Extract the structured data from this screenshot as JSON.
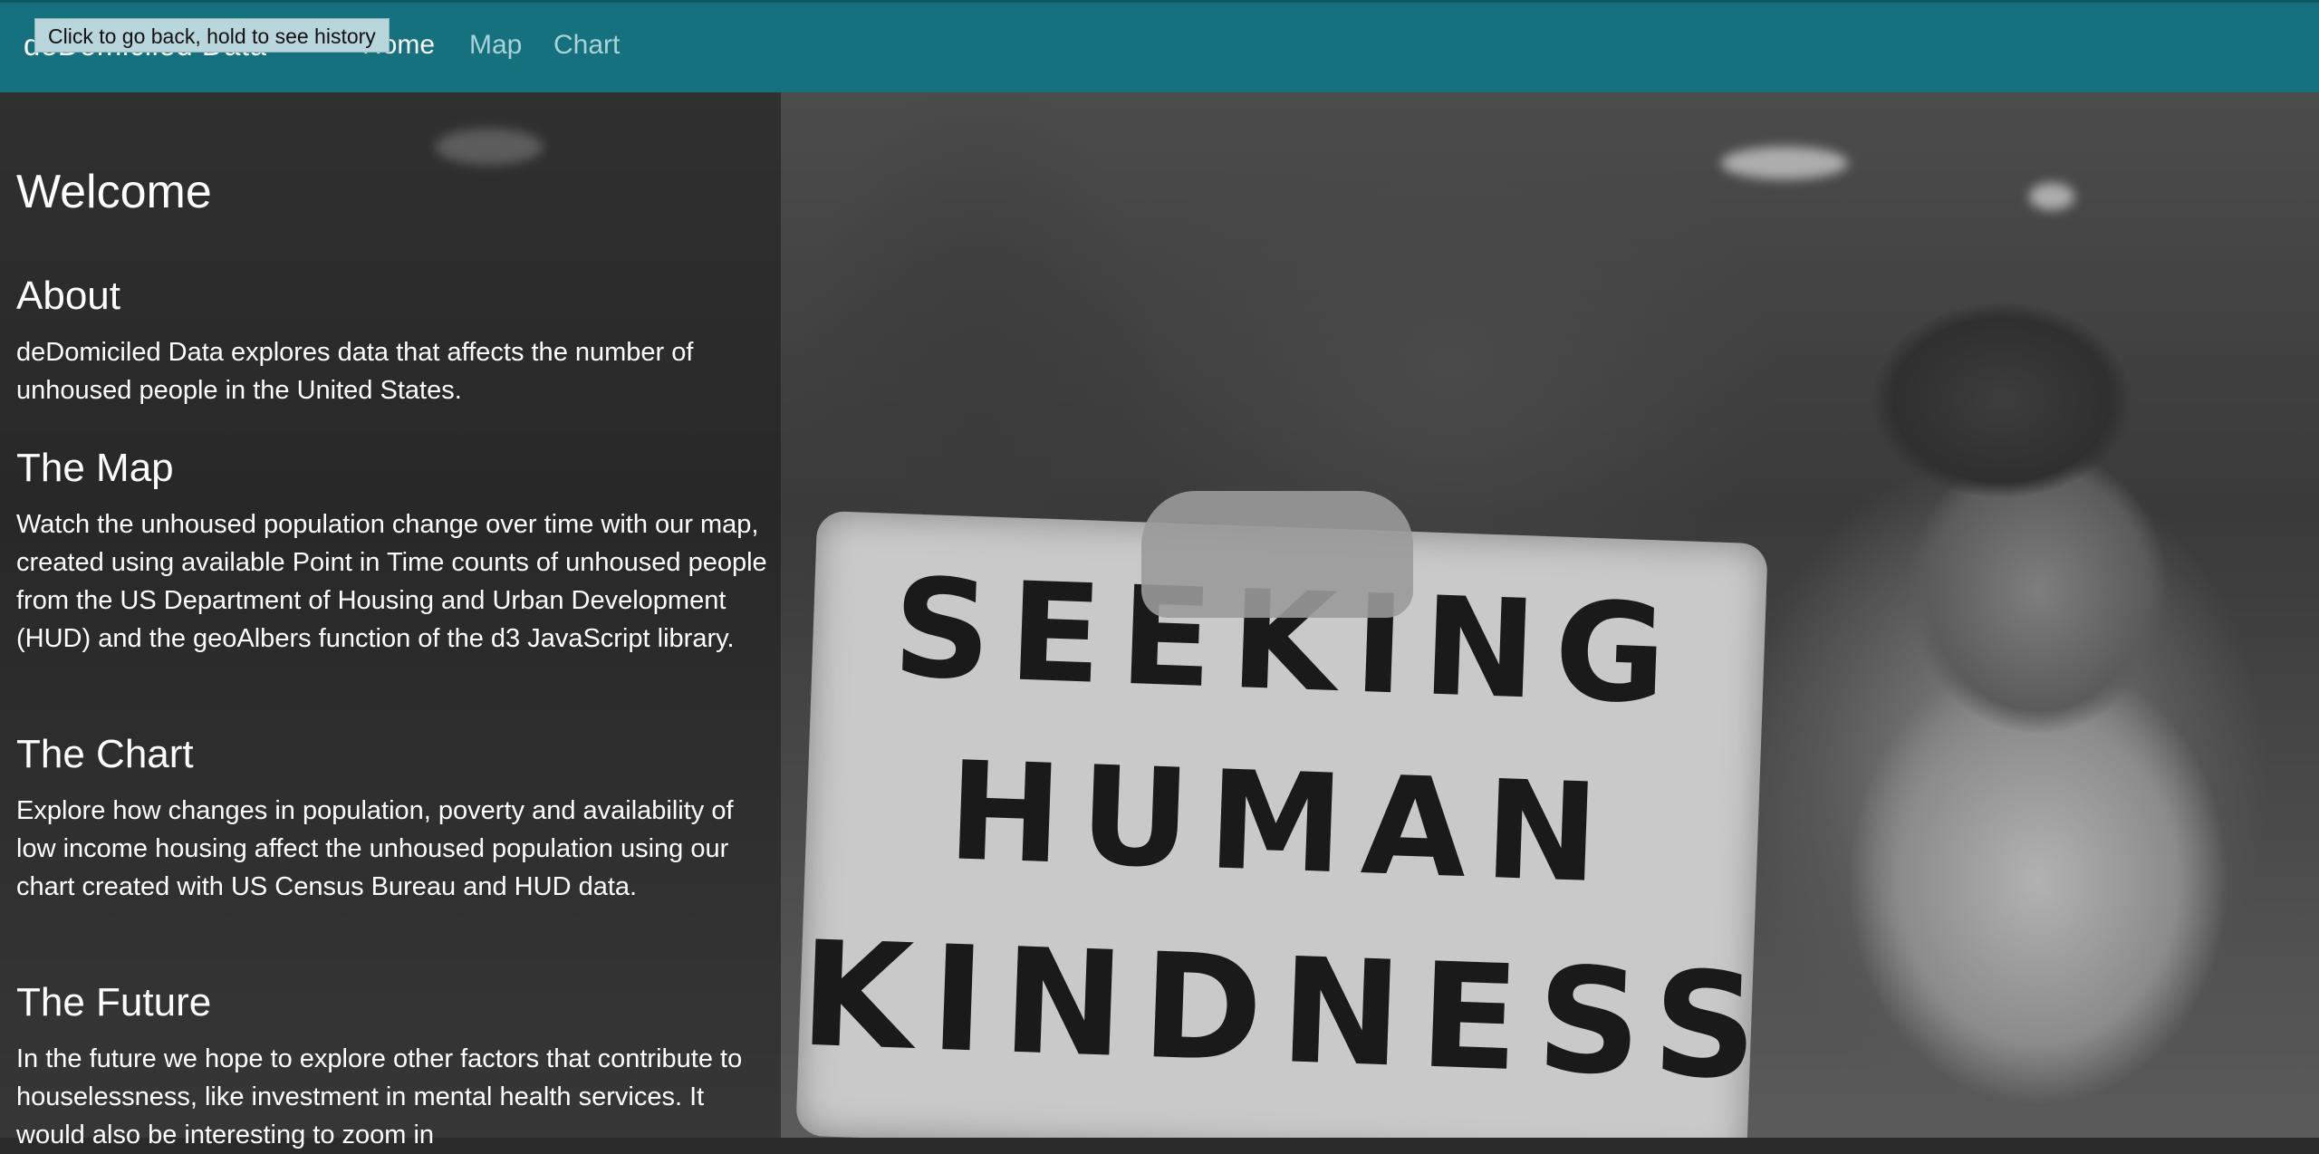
{
  "navbar": {
    "brand": "deDomiciled Data",
    "links": [
      {
        "label": "Home",
        "active": true
      },
      {
        "label": "Map",
        "active": false
      },
      {
        "label": "Chart",
        "active": false
      }
    ],
    "color": "#16717f"
  },
  "tooltip": {
    "text": "Click to go back, hold to see history"
  },
  "hero": {
    "sign_lines": [
      "SEEKING",
      "HUMAN",
      "KINDNESS"
    ]
  },
  "content": {
    "welcome": "Welcome",
    "sections": [
      {
        "heading": "About",
        "text": "deDomiciled Data explores data that affects the number of unhoused people in the United States."
      },
      {
        "heading": "The Map",
        "text": "Watch the unhoused population change over time with our map, created using available Point in Time counts of unhoused people from the US Department of Housing and Urban Development (HUD) and the geoAlbers function of the d3 JavaScript library."
      },
      {
        "heading": "The Chart",
        "text": "Explore how changes in population, poverty and availability of low income housing affect the unhoused population using our chart created with US Census Bureau and HUD data."
      },
      {
        "heading": "The Future",
        "text": "In the future we hope to explore other factors that contribute to houselessness, like investment in mental health services. It would also be interesting to zoom in"
      }
    ]
  }
}
